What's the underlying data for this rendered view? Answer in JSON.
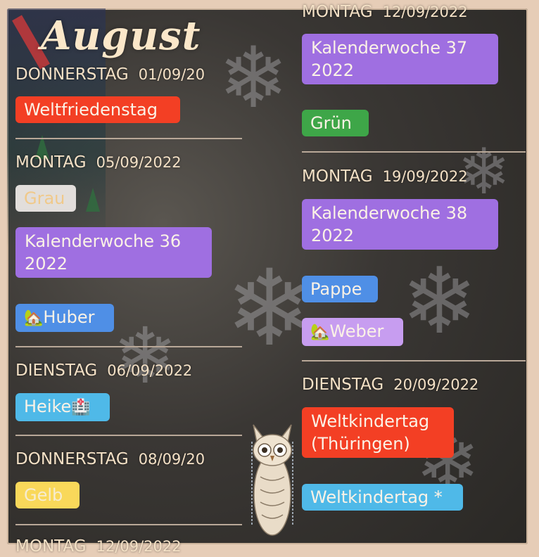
{
  "month_title": "August",
  "left": {
    "day1": {
      "weekday": "DONNERSTAG",
      "date": "01/09/20",
      "chip": "Weltfriedenstag"
    },
    "day2": {
      "weekday": "MONTAG",
      "date": "05/09/2022",
      "chip_a": "Grau",
      "chip_b": "Kalenderwoche 36 2022",
      "chip_c_icon": "🏡",
      "chip_c": "Huber"
    },
    "day3": {
      "weekday": "DIENSTAG",
      "date": "06/09/2022",
      "chip": "Heike",
      "chip_icon": "🏥"
    },
    "day4": {
      "weekday": "DONNERSTAG",
      "date": "08/09/20",
      "chip": "Gelb"
    },
    "day5": {
      "weekday": "MONTAG",
      "date": "12/09/2022"
    }
  },
  "right": {
    "day1": {
      "weekday": "MONTAG",
      "date": "12/09/2022",
      "chip_a": "Kalenderwoche 37 2022",
      "chip_b": "Grün"
    },
    "day2": {
      "weekday": "MONTAG",
      "date": "19/09/2022",
      "chip_a": "Kalenderwoche 38 2022",
      "chip_b": "Pappe",
      "chip_c_icon": "🏡",
      "chip_c": "Weber"
    },
    "day3": {
      "weekday": "DIENSTAG",
      "date": "20/09/2022",
      "chip_a": "Weltkindertag (Thüringen)",
      "chip_b": "Weltkindertag *"
    }
  },
  "colors": {
    "red": "#f33f24",
    "purple": "#9f6fe1",
    "blue": "#4f8fe6",
    "cyan": "#4fb9e8",
    "yellow": "#f9d85a",
    "green": "#3ea648",
    "lilac": "#c79df0",
    "grey": "#e2dedb"
  },
  "icons": [
    "house-with-garden-icon",
    "hospital-icon",
    "owl-figurine-icon",
    "snowflake-icon"
  ]
}
